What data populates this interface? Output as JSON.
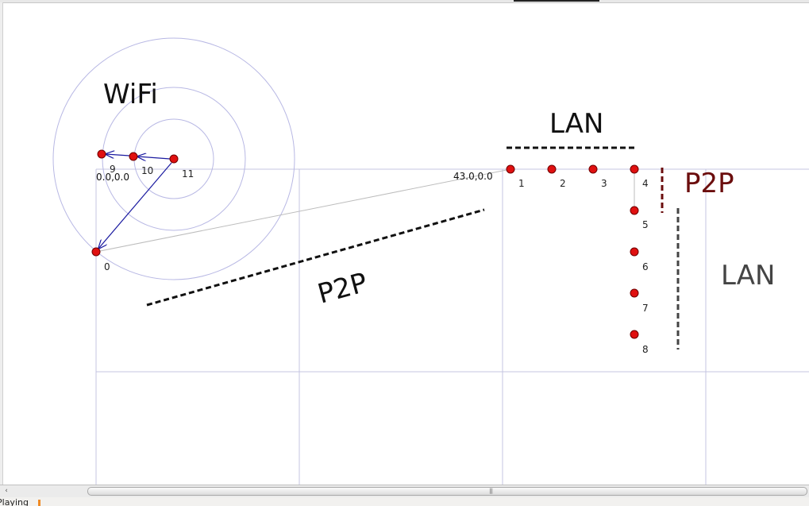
{
  "nodes": [
    {
      "id": "0",
      "label": "0"
    },
    {
      "id": "1",
      "label": "1"
    },
    {
      "id": "2",
      "label": "2"
    },
    {
      "id": "3",
      "label": "3"
    },
    {
      "id": "4",
      "label": "4"
    },
    {
      "id": "5",
      "label": "5"
    },
    {
      "id": "6",
      "label": "6"
    },
    {
      "id": "7",
      "label": "7"
    },
    {
      "id": "8",
      "label": "8"
    },
    {
      "id": "9",
      "label": "9"
    },
    {
      "id": "10",
      "label": "10"
    },
    {
      "id": "11",
      "label": "11"
    }
  ],
  "coordinates": {
    "origin": "0.0,0.0",
    "lan_origin": "43.0,0.0"
  },
  "annotations": {
    "wifi": "WiFi",
    "lan_top": "LAN",
    "lan_right": "LAN",
    "p2p_diagonal": "P2P",
    "p2p_right": "P2P"
  },
  "status": {
    "text": "Playing"
  },
  "colors": {
    "node_fill": "#e01010",
    "node_stroke": "#700000",
    "wifi_link": "#1a1aa0",
    "wifi_ring": "#b8b8e4",
    "grid": "#c4c4e0",
    "p2p_right": "#6b0d0d",
    "lan_right": "#444444"
  },
  "icons": {
    "scroll_left": "scroll-left-arrow-icon",
    "scroll_grip": "scroll-grip-icon"
  }
}
